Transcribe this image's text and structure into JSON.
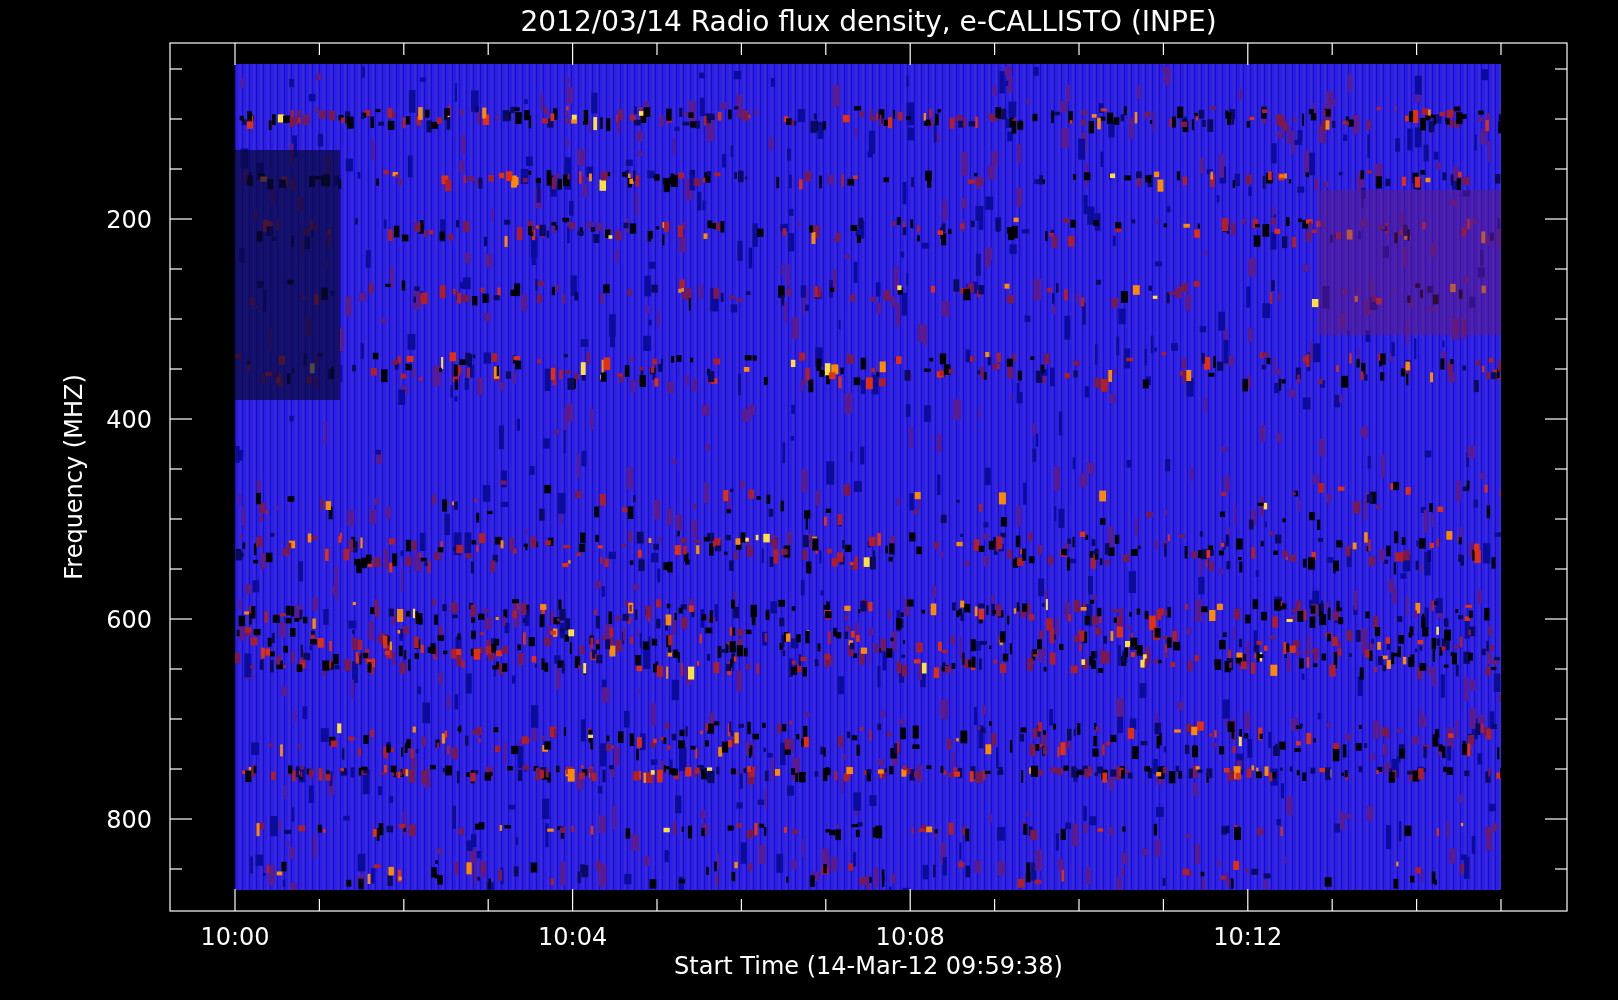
{
  "title": "2012/03/14  Radio flux density, e-CALLISTO (INPE)",
  "y_axis": {
    "label": "Frequency (MHZ)",
    "ticks": [
      "200",
      "400",
      "600",
      "800"
    ]
  },
  "x_axis": {
    "label": "Start Time (14-Mar-12 09:59:38)",
    "ticks": [
      "10:00",
      "10:04",
      "10:08",
      "10:12"
    ]
  }
}
